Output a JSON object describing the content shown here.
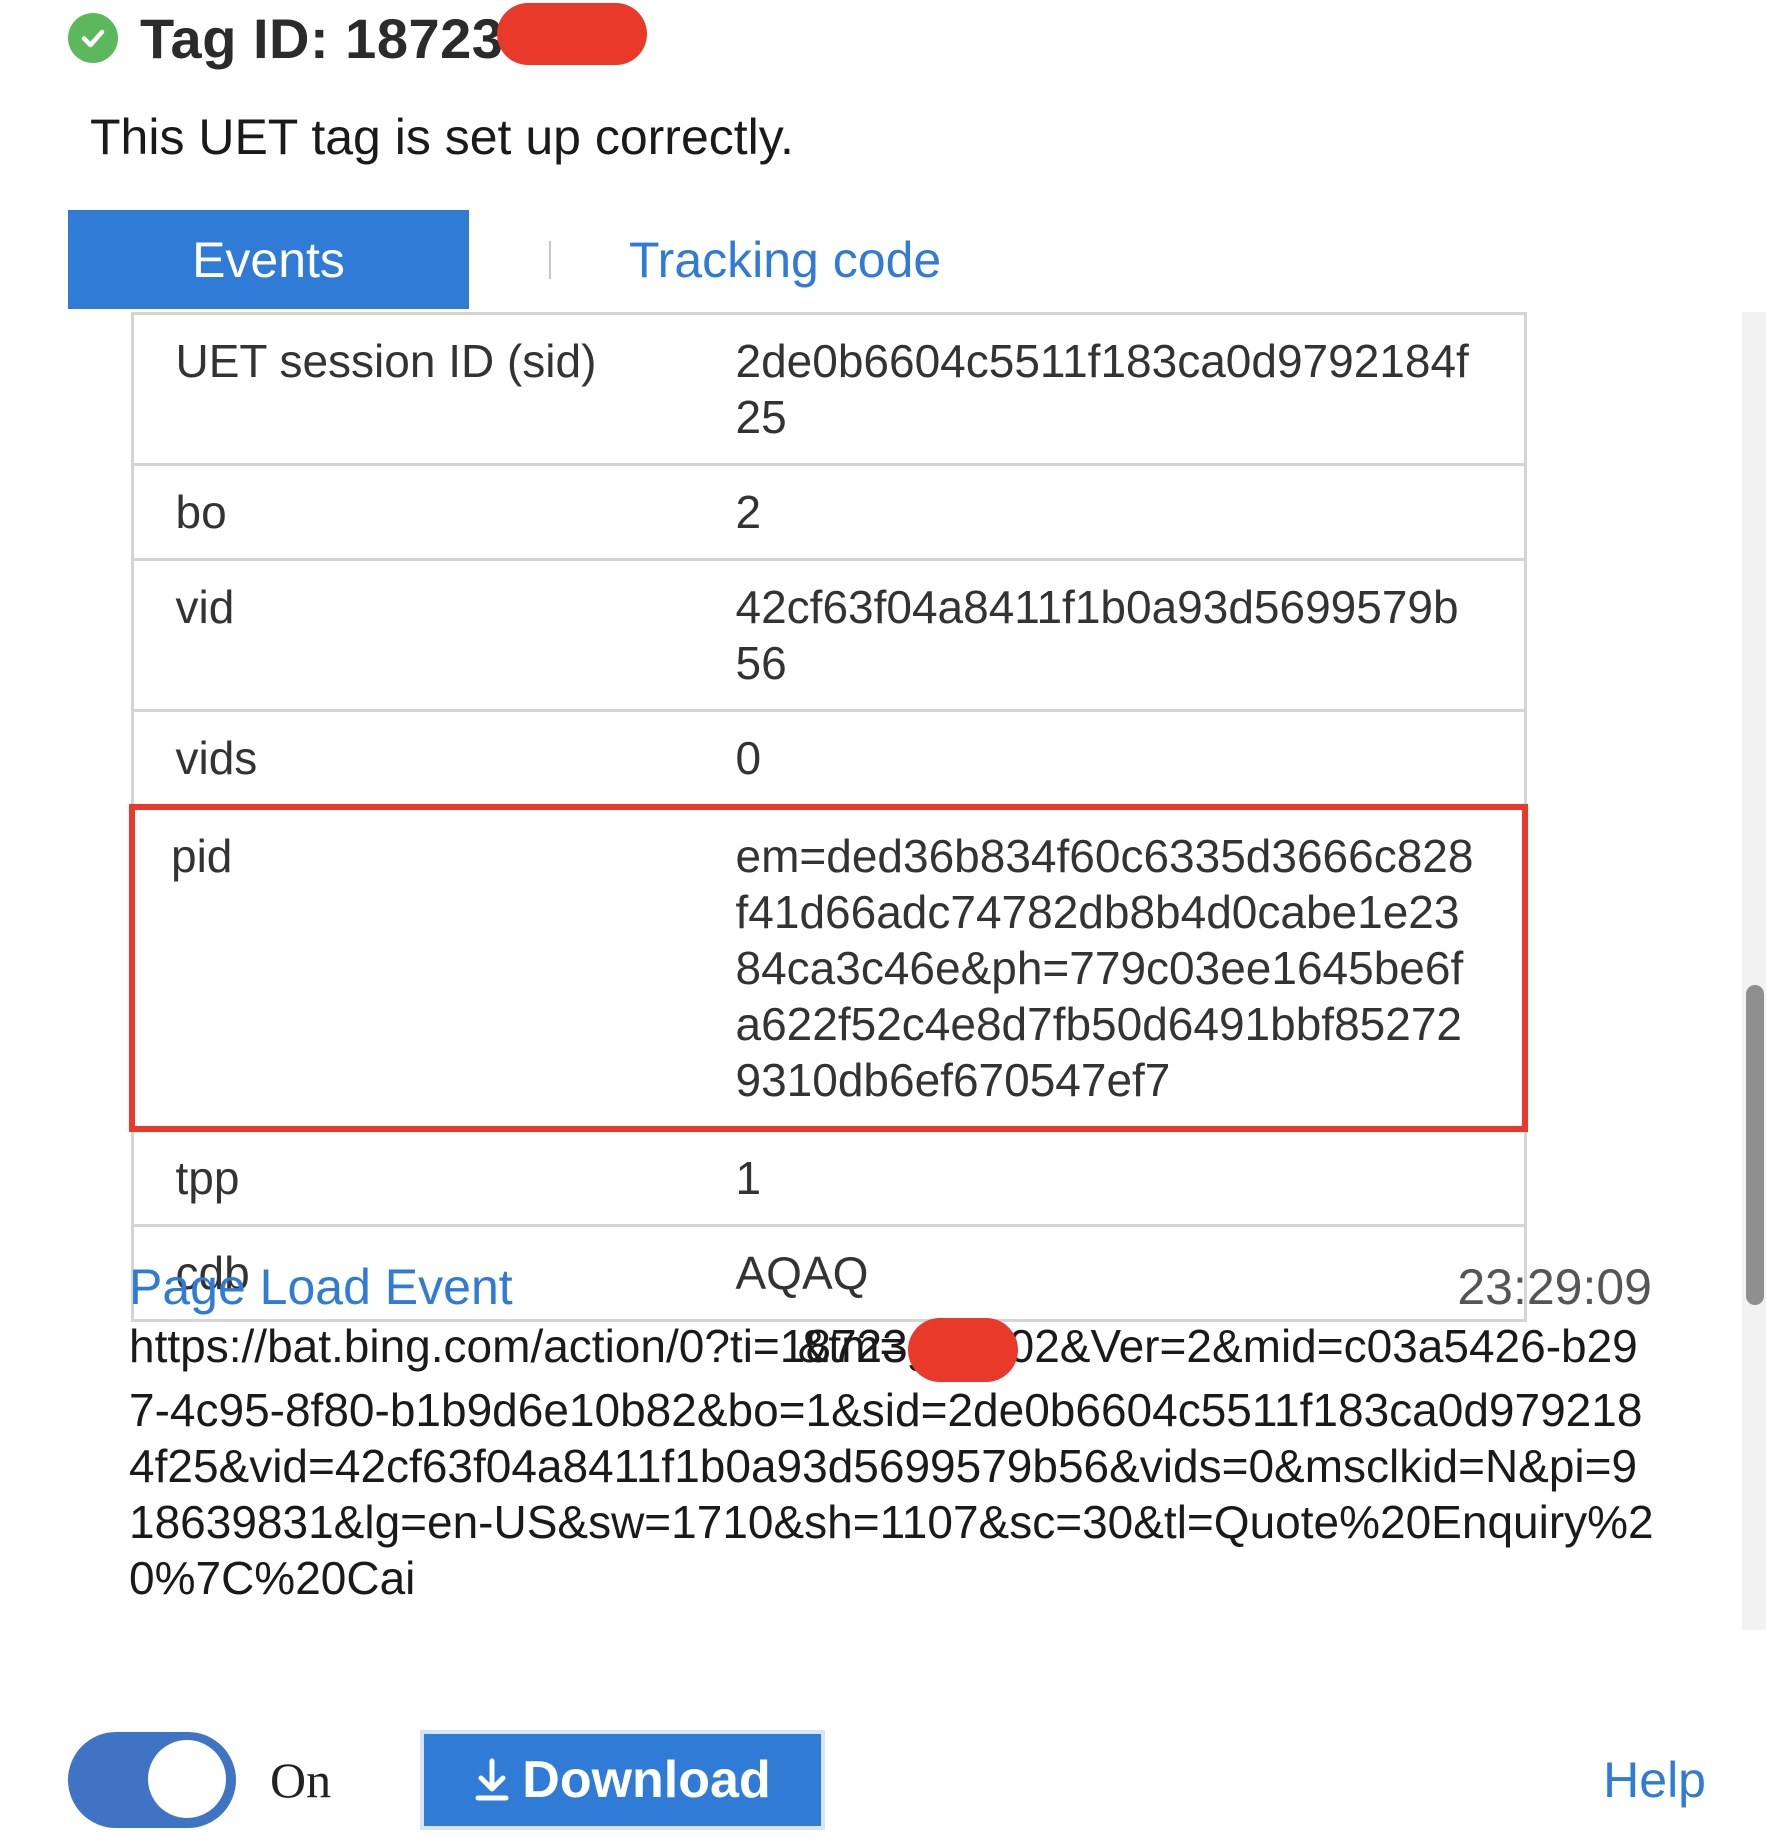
{
  "header": {
    "title": "Tag ID: 18723",
    "status": "This UET tag is set up correctly.",
    "status_icon": "check-circle-icon",
    "status_color": "#5cb85c"
  },
  "tabs": [
    {
      "label": "Events",
      "active": true
    },
    {
      "label": "Tracking code",
      "active": false
    }
  ],
  "params": [
    {
      "key": "UET session ID (sid)",
      "value": "2de0b6604c5511f183ca0d9792184f25"
    },
    {
      "key": "bo",
      "value": "2"
    },
    {
      "key": "vid",
      "value": "42cf63f04a8411f1b0a93d5699579b56"
    },
    {
      "key": "vids",
      "value": "0"
    },
    {
      "key": "pid",
      "value": "em=ded36b834f60c6335d3666c828f41d66adc74782db8b4d0cabe1e2384ca3c46e&ph=779c03ee1645be6fa622f52c4e8d7fb50d6491bbf852729310db6ef670547ef7",
      "highlighted": true
    },
    {
      "key": "tpp",
      "value": "1"
    },
    {
      "key": "cdb",
      "value": "AQAQ"
    }
  ],
  "event": {
    "name": "Page Load Event",
    "time": "23:29:09",
    "url_part1": "https://bat.bing.com/action/0?ti=18723",
    "url_part2": "&tm=gtm002&Ver=2&mid=c03a5426-b297-4c95-8f80-b1b9d6e10b82&bo=1&sid=2de0b6604c5511f183ca0d9792184f25&vid=42cf63f04a8411f1b0a93d5699579b56&vids=0&msclkid=N&pi=918639831&lg=en-US&sw=1710&sh=1107&sc=30&tl=Quote%20Enquiry%20%7C%20Cai"
  },
  "footer": {
    "toggle_label": "On",
    "toggle_on": true,
    "download_label": "Download",
    "help_label": "Help"
  },
  "colors": {
    "accent": "#2f7bd6",
    "highlight": "#e8392b",
    "toggle": "#3f74c4"
  }
}
